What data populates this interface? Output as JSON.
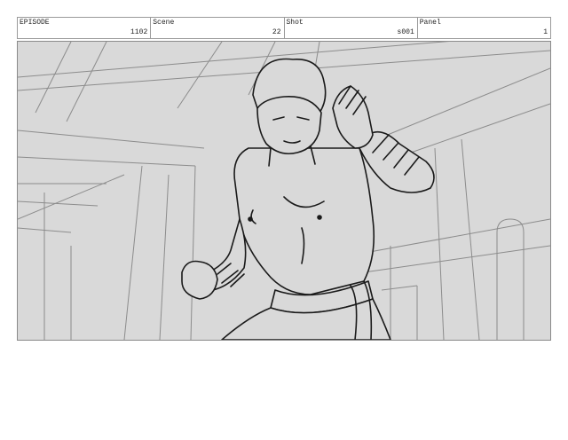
{
  "header": {
    "fields": [
      {
        "label": "EPISODE",
        "value": "1102"
      },
      {
        "label": "Scene",
        "value": "22"
      },
      {
        "label": "Shot",
        "value": "s001"
      },
      {
        "label": "Panel",
        "value": "1"
      }
    ]
  },
  "panel": {
    "background_color": "#d9d9d9",
    "line_color": "#1a1a1a"
  }
}
